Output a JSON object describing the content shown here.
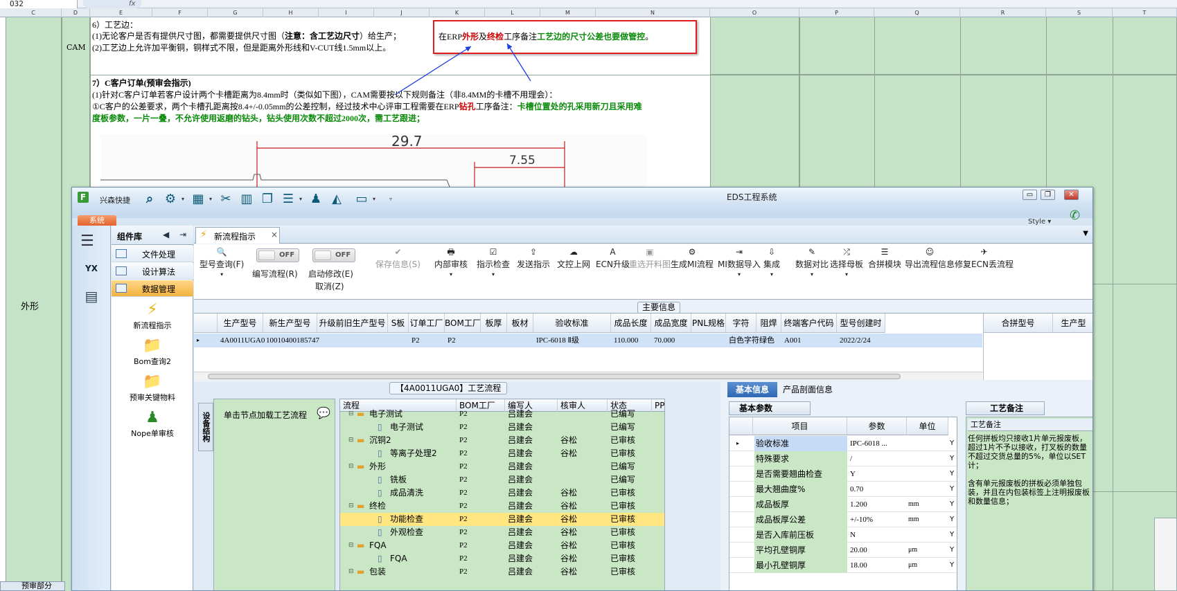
{
  "sheet": {
    "name_box": "O32",
    "fx": "fx",
    "columns": [
      "C",
      "D",
      "E",
      "F",
      "G",
      "H",
      "I",
      "J",
      "K",
      "L",
      "M",
      "N",
      "O",
      "P",
      "Q",
      "R",
      "S",
      "T"
    ],
    "left_label": "外形",
    "cam_label": "CAM",
    "section6": {
      "title": "6）工艺边：",
      "line1_a": "(1)无论客户是否有提供尺寸图，都需要提供尺寸图（",
      "line1_b": "注意：含工艺边尺寸",
      "line1_c": "）给生产；",
      "line2": "(2)工艺边上允许加平衡铜，铜样式不限，但是距离外形线和V-CUT线1.5mm以上。"
    },
    "callout": {
      "a": "在ERP",
      "b": "外形",
      "c": "及",
      "d": "终检",
      "e": "工序备注",
      "f": "工艺边的尺寸公差也要做管控",
      "g": "。"
    },
    "section7": {
      "title": "7）C客户订单(预审会指示)",
      "line1": "(1)针对C客户订单若客户设计两个卡槽距离为8.4mm时（类似如下图），CAM需要按以下规则备注（非8.4MM的卡槽不用理会）：",
      "line2_a": "①C客户的公差要求，两个卡槽孔距离按8.4+/-0.05mm的公差控制，经过技术中心评审工程需要在ERP",
      "line2_b": "钻孔",
      "line2_c": "工序备注：",
      "line2_d": "卡槽位置处的孔采用新刀且采用难",
      "line3": "度板参数，一片一叠，不允许使用返磨的钻头，钻头使用次数不超过2000次，需工艺跟进；"
    },
    "drawing": {
      "dim1": "29.7",
      "dim2": "7.55"
    },
    "bottom_tab": "预审部分"
  },
  "window": {
    "quick_access": "兴森快捷",
    "title": "EDS工程系统",
    "style_label": "Style",
    "system_tab": "系统",
    "toolbar_icons": [
      "search-icon",
      "gear-icon",
      "grid-icon",
      "scissors-icon",
      "film-icon",
      "copy-icon",
      "list-icon",
      "user-icon",
      "chart-icon",
      "monitor-icon"
    ]
  },
  "components": {
    "title": "组件库",
    "items": [
      {
        "label": "文件处理"
      },
      {
        "label": "设计算法"
      },
      {
        "label": "数据管理"
      }
    ],
    "tools": [
      {
        "label": "新流程指示"
      },
      {
        "label": "Bom查询2"
      },
      {
        "label": "预审关键物料"
      },
      {
        "label": "Nope单审核"
      }
    ],
    "rail_logo": "YX"
  },
  "tab": {
    "label": "新流程指示",
    "close": "×"
  },
  "ribbon": {
    "buttons": [
      {
        "icon": "🔍",
        "label": "型号查询(F)",
        "dd": "▾"
      },
      {
        "label": "编写流程(R)",
        "toggle": "OFF"
      },
      {
        "label": "启动修改(E)",
        "sub": "取消(Z)",
        "toggle": "OFF"
      },
      {
        "icon": "✔",
        "label": "保存信息(S)",
        "disabled": true
      },
      {
        "icon": "🖶",
        "label": "内部审核",
        "dd": "▾"
      },
      {
        "icon": "☑",
        "label": "指示检查",
        "dd": "▾"
      },
      {
        "icon": "⇪",
        "label": "发送指示"
      },
      {
        "icon": "☁",
        "label": "文控上网"
      },
      {
        "icon": "A",
        "label": "ECN升级"
      },
      {
        "icon": "▣",
        "label": "重选开料图",
        "disabled": true
      },
      {
        "icon": "⚙",
        "label": "生成MI流程"
      },
      {
        "icon": "⇥",
        "label": "MI数据导入",
        "dd": "▾"
      },
      {
        "icon": "⇩",
        "label": "集成",
        "dd": "▾"
      },
      {
        "icon": "✎",
        "label": "数据对比",
        "dd": "▾"
      },
      {
        "icon": "⤮",
        "label": "选择母板",
        "dd": "▾"
      },
      {
        "icon": "☰",
        "label": "合拼模块"
      },
      {
        "icon": "☺",
        "label": "导出流程信息"
      },
      {
        "icon": "✈",
        "label": "修复ECN丢流程"
      }
    ]
  },
  "main_info": {
    "title": "主要信息",
    "columns": [
      "生产型号",
      "新生产型号",
      "升级前旧生产型号",
      "S板",
      "订单工厂",
      "BOM工厂",
      "板厚",
      "板材",
      "验收标准",
      "成品长度",
      "成品宽度",
      "PNL规格",
      "字符",
      "阻焊",
      "终端客户代码",
      "型号创建时"
    ],
    "row": [
      "4A0011UGA0",
      "10010400185747",
      "",
      "",
      "P2",
      "P2",
      "",
      "",
      "IPC-6018 Ⅱ级",
      "110.000",
      "70.000",
      "",
      "白色字符",
      "绿色",
      "A001",
      "2022/2/24"
    ],
    "side_columns": [
      "合拼型号",
      "生产型"
    ]
  },
  "process": {
    "title": "【4A0011UGA0】工艺流程",
    "vertical_tab": "设备结构",
    "load_hint": "单击节点加载工艺流程",
    "columns": [
      "流程",
      "BOM工厂",
      "编写人",
      "核审人",
      "状态",
      "PPC"
    ],
    "rows": [
      {
        "name": "电子测试",
        "type": "folder",
        "level": 1,
        "bom": "P2",
        "writer": "吕建会",
        "reviewer": "",
        "status": "已编写"
      },
      {
        "name": "电子测试",
        "type": "doc",
        "level": 2,
        "bom": "P2",
        "writer": "吕建会",
        "reviewer": "",
        "status": "已编写"
      },
      {
        "name": "沉铜2",
        "type": "folder",
        "level": 1,
        "bom": "P2",
        "writer": "吕建会",
        "reviewer": "谷松",
        "status": "已审核"
      },
      {
        "name": "等离子处理2",
        "type": "doc",
        "level": 2,
        "bom": "P2",
        "writer": "吕建会",
        "reviewer": "谷松",
        "status": "已审核"
      },
      {
        "name": "外形",
        "type": "folder",
        "level": 1,
        "bom": "P2",
        "writer": "吕建会",
        "reviewer": "",
        "status": "已编写"
      },
      {
        "name": "铣板",
        "type": "doc",
        "level": 2,
        "bom": "P2",
        "writer": "吕建会",
        "reviewer": "",
        "status": "已编写"
      },
      {
        "name": "成品清洗",
        "type": "doc",
        "level": 2,
        "bom": "P2",
        "writer": "吕建会",
        "reviewer": "谷松",
        "status": "已审核"
      },
      {
        "name": "终检",
        "type": "folder",
        "level": 1,
        "bom": "P2",
        "writer": "吕建会",
        "reviewer": "谷松",
        "status": "已审核"
      },
      {
        "name": "功能检查",
        "type": "doc",
        "level": 2,
        "bom": "P2",
        "writer": "吕建会",
        "reviewer": "谷松",
        "status": "已审核",
        "selected": true
      },
      {
        "name": "外观检查",
        "type": "doc",
        "level": 2,
        "bom": "P2",
        "writer": "吕建会",
        "reviewer": "谷松",
        "status": "已审核"
      },
      {
        "name": "FQA",
        "type": "folder",
        "level": 1,
        "bom": "P2",
        "writer": "吕建会",
        "reviewer": "谷松",
        "status": "已审核"
      },
      {
        "name": "FQA",
        "type": "doc",
        "level": 2,
        "bom": "P2",
        "writer": "吕建会",
        "reviewer": "谷松",
        "status": "已审核"
      },
      {
        "name": "包装",
        "type": "folder",
        "level": 1,
        "bom": "P2",
        "writer": "吕建会",
        "reviewer": "谷松",
        "status": "已审核"
      }
    ]
  },
  "basic": {
    "tabs": [
      "基本信息",
      "产品剖面信息"
    ],
    "params_title": "基本参数",
    "columns": [
      "项目",
      "参数",
      "单位"
    ],
    "rows": [
      {
        "k": "验收标准",
        "v": "IPC-6018 ...",
        "u": "",
        "y": "Y",
        "selected": true
      },
      {
        "k": "特殊要求",
        "v": "/",
        "u": "",
        "y": "Y"
      },
      {
        "k": "是否需要翘曲检查",
        "v": "Y",
        "u": "",
        "y": "Y"
      },
      {
        "k": "最大翘曲度%",
        "v": "0.70",
        "u": "",
        "y": "Y"
      },
      {
        "k": "成品板厚",
        "v": "1.200",
        "u": "mm",
        "y": "Y"
      },
      {
        "k": "成品板厚公差",
        "v": "+/-10%",
        "u": "mm",
        "y": "Y"
      },
      {
        "k": "是否入库前压板",
        "v": "N",
        "u": "",
        "y": "Y"
      },
      {
        "k": "平均孔壁铜厚",
        "v": "20.00",
        "u": "μm",
        "y": "Y"
      },
      {
        "k": "最小孔壁铜厚",
        "v": "18.00",
        "u": "μm",
        "y": "Y"
      }
    ],
    "remark_title": "工艺备注",
    "remark_label": "工艺备注",
    "remark_text": "任何拼板均只接收1片单元报废板，超过1片不予以接收，打叉板的数量不超过交货总量的5%，单位以SET计；\n\n含有单元报废板的拼板必须单独包装，并且在内包装标签上注明报废板和数量信息；"
  }
}
